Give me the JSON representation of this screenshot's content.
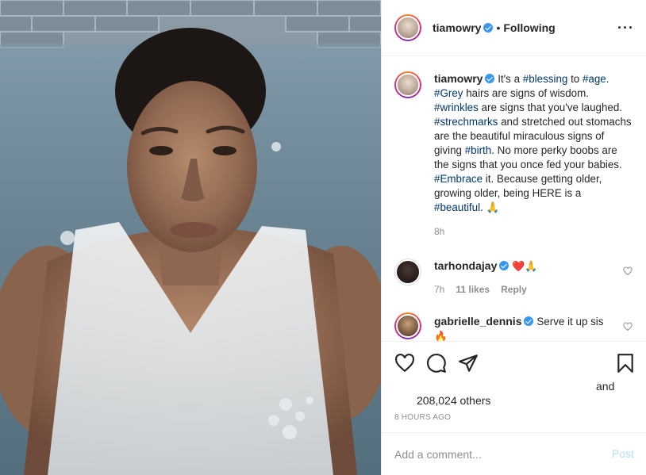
{
  "post": {
    "username": "tiamowry",
    "follow_state": "Following",
    "separator": "•",
    "more_icon": "more-horizontal-icon"
  },
  "caption": {
    "username": "tiamowry",
    "segments": [
      {
        "text": " It's a ",
        "tag": false
      },
      {
        "text": "#blessing",
        "tag": true
      },
      {
        "text": " to ",
        "tag": false
      },
      {
        "text": "#age",
        "tag": true
      },
      {
        "text": ". ",
        "tag": false
      },
      {
        "text": "#Grey",
        "tag": true
      },
      {
        "text": " hairs are signs of wisdom. ",
        "tag": false
      },
      {
        "text": "#wrinkles",
        "tag": true
      },
      {
        "text": " are signs that you've laughed. ",
        "tag": false
      },
      {
        "text": "#strechmarks",
        "tag": true
      },
      {
        "text": " and stretched out stomachs are the beautiful miraculous signs of giving ",
        "tag": false
      },
      {
        "text": "#birth",
        "tag": true
      },
      {
        "text": ". No more perky boobs are the signs that you once fed your babies. ",
        "tag": false
      },
      {
        "text": "#Embrace",
        "tag": true
      },
      {
        "text": " it. Because getting older, growing older, being HERE is a ",
        "tag": false
      },
      {
        "text": "#beautiful",
        "tag": true
      },
      {
        "text": ". 🙏",
        "tag": false
      }
    ],
    "time": "8h"
  },
  "comments": [
    {
      "username": "tarhondajay",
      "text": "❤️🙏",
      "time": "7h",
      "likes": "11 likes",
      "reply": "Reply"
    },
    {
      "username": "gabrielle_dennis",
      "text": "Serve it up sis 🔥",
      "time": "",
      "likes": "",
      "reply": ""
    }
  ],
  "actions": {
    "like_icon": "heart-icon",
    "comment_icon": "comment-icon",
    "share_icon": "share-icon",
    "save_icon": "bookmark-icon",
    "and_text": "and",
    "likes_text": "208,024 others",
    "posted_time": "8 HOURS AGO"
  },
  "add_comment": {
    "placeholder": "Add a comment...",
    "post_label": "Post"
  },
  "colors": {
    "hashtag": "#00376b",
    "verified": "#3897f0",
    "post_button_disabled": "#b2dffc",
    "muted": "#8e8e8e"
  }
}
